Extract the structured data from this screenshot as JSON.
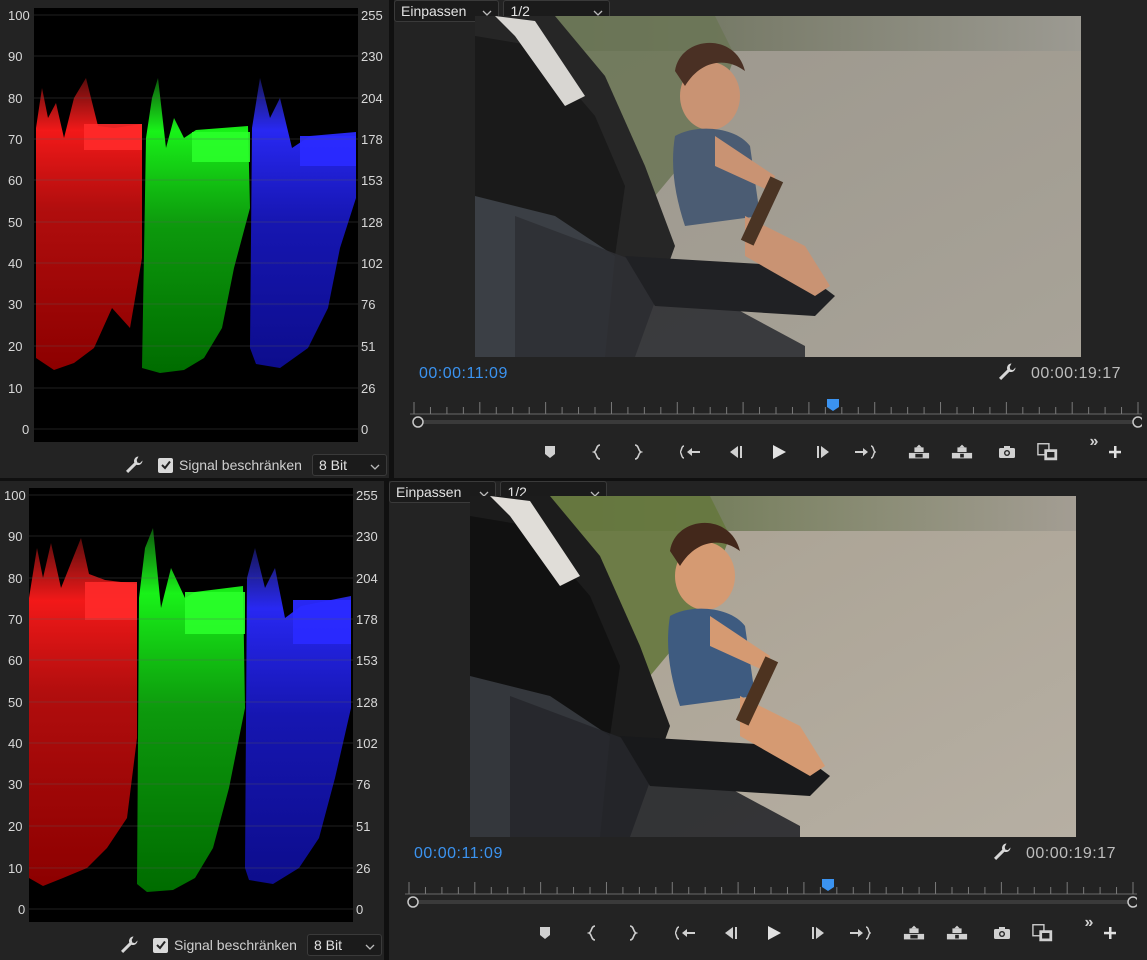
{
  "scopes": [
    {
      "left_axis": [
        "100",
        "90",
        "80",
        "70",
        "60",
        "50",
        "40",
        "30",
        "20",
        "10",
        "0"
      ],
      "right_axis": [
        "255",
        "230",
        "204",
        "178",
        "153",
        "128",
        "102",
        "76",
        "51",
        "26",
        "0"
      ],
      "signal_label": "Signal beschränken",
      "signal_checked": true,
      "bit_depth": "8 Bit"
    },
    {
      "left_axis": [
        "100",
        "90",
        "80",
        "70",
        "60",
        "50",
        "40",
        "30",
        "20",
        "10",
        "0"
      ],
      "right_axis": [
        "255",
        "230",
        "204",
        "178",
        "153",
        "128",
        "102",
        "76",
        "51",
        "26",
        "0"
      ],
      "signal_label": "Signal beschränken",
      "signal_checked": true,
      "bit_depth": "8 Bit"
    }
  ],
  "monitors": [
    {
      "timecode_current": "00:00:11:09",
      "zoom": "Einpassen",
      "resolution": "1/2",
      "timecode_duration": "00:00:19:17",
      "playhead_fraction": 0.58
    },
    {
      "timecode_current": "00:00:11:09",
      "zoom": "Einpassen",
      "resolution": "1/2",
      "timecode_duration": "00:00:19:17",
      "playhead_fraction": 0.58
    }
  ],
  "icons": {
    "wrench": "wrench-icon",
    "marker": "marker-icon",
    "in": "mark-in-icon",
    "out": "mark-out-icon",
    "go_in": "go-to-in-icon",
    "step_back": "step-back-icon",
    "play": "play-icon",
    "step_fwd": "step-forward-icon",
    "go_out": "go-to-out-icon",
    "lift": "lift-icon",
    "extract": "extract-icon",
    "camera": "export-frame-icon",
    "compare": "comparison-view-icon",
    "more": "more-icon",
    "add": "add-button-icon"
  },
  "colors": {
    "accent": "#3b93f0",
    "panel": "#232323",
    "red": "#ff1a1a",
    "green": "#1aff1a",
    "blue": "#2a2aff"
  }
}
